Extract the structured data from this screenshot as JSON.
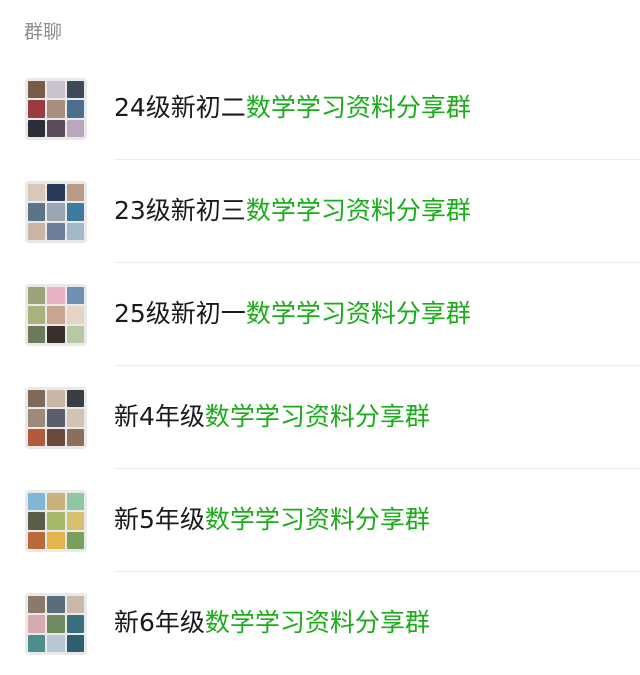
{
  "section_title": "群聊",
  "colors": {
    "highlight": "#1aad19",
    "text": "#1a1a1a",
    "section_title": "#8e8e8e"
  },
  "groups": [
    {
      "prefix": "24级新初二",
      "keyword": "数学学习资料分享群",
      "avatar_tiles": [
        "#7a5b4a",
        "#c9c2cf",
        "#3e4a59",
        "#9c3b3f",
        "#a68f7e",
        "#4d6e8f",
        "#2c2e36",
        "#5d4c5a",
        "#b9a7bd"
      ]
    },
    {
      "prefix": "23级新初三",
      "keyword": "数学学习资料分享群",
      "avatar_tiles": [
        "#d7c8b8",
        "#283a5a",
        "#b99a86",
        "#5b7488",
        "#98a6b2",
        "#3f7aa1",
        "#c8b5a5",
        "#6e7f9a",
        "#a5b8c8"
      ]
    },
    {
      "prefix": "25级新初一",
      "keyword": "数学学习资料分享群",
      "avatar_tiles": [
        "#9ba37a",
        "#e7b3c4",
        "#6f8fb5",
        "#a8b37c",
        "#c9a58e",
        "#e5d3c7",
        "#6b7b5b",
        "#3a2f2c",
        "#b7c8a3"
      ]
    },
    {
      "prefix": "新4年级",
      "keyword": "数学学习资料分享群",
      "avatar_tiles": [
        "#7d6a5a",
        "#c8b7a6",
        "#3b3d45",
        "#9d8a7a",
        "#5c5f6b",
        "#d3c3b4",
        "#b25a3a",
        "#6a4a3a",
        "#8a6f5e"
      ]
    },
    {
      "prefix": "新5年级",
      "keyword": "数学学习资料分享群",
      "avatar_tiles": [
        "#7fb7d9",
        "#c9b27a",
        "#8fc7a5",
        "#5a5d4a",
        "#a7b86a",
        "#d6c06f",
        "#b86a3a",
        "#e2b64c",
        "#7a9f5a"
      ]
    },
    {
      "prefix": "新6年级",
      "keyword": "数学学习资料分享群",
      "avatar_tiles": [
        "#8a7a6a",
        "#5b6c7b",
        "#c8b9a8",
        "#d7a9b0",
        "#6f8b5f",
        "#3a6f7f",
        "#4c8f8a",
        "#b8c7d3",
        "#2f5f6f"
      ]
    }
  ]
}
